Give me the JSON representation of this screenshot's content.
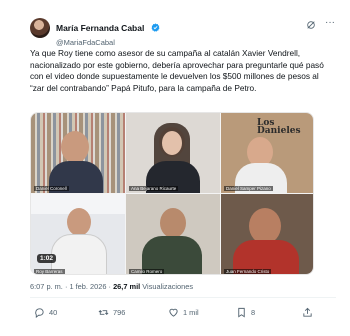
{
  "author": {
    "display_name": "María Fernanda Cabal",
    "handle": "@MariaFdaCabal"
  },
  "tweet": {
    "text": "Ya que Roy tiene como asesor de su campaña al catalán Xavier Vendrell, nacionalizado por este gobierno, debería aprovechar para preguntarle qué pasó con el video donde supuestamente le devuelven los $500 millones de pesos al “zar del contrabando” Papá Pitufo, para la campaña de Petro."
  },
  "video": {
    "duration": "1:02",
    "participants": [
      "Daniel Coronell",
      "Ana Bejarano Ricaurte",
      "Daniel Samper Pizano",
      "Roy Barreras",
      "Camilo Romero",
      "Juan Fernando Cristo"
    ],
    "overlay_text": "Los Danieles"
  },
  "meta": {
    "time": "6:07 p. m.",
    "separator": "·",
    "date": "1 feb. 2026",
    "views_count": "26,7 mil",
    "views_label": "Visualizaciones"
  },
  "actions": {
    "replies": "40",
    "reposts": "796",
    "likes": "1 mil",
    "bookmarks": "8"
  },
  "colors": {
    "verified": "#1d9bf0",
    "secondary_text": "#536471",
    "primary_text": "#0f1419"
  }
}
